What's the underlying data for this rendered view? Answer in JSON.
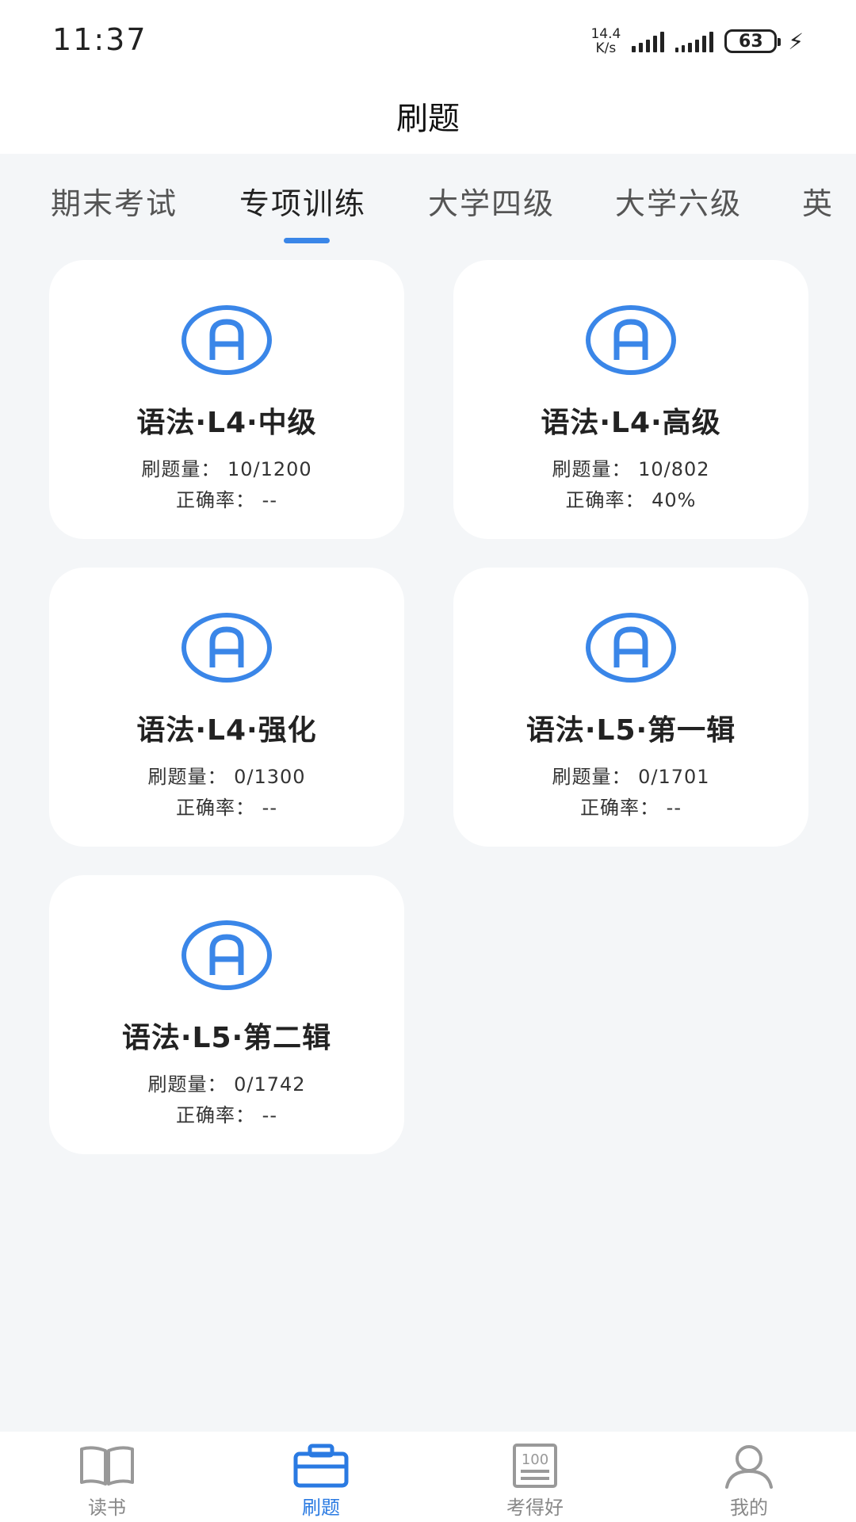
{
  "status_bar": {
    "time": "11:37",
    "net_speed_value": "14.4",
    "net_speed_unit": "K/s",
    "battery": "63"
  },
  "header": {
    "title": "刷题"
  },
  "tabs": [
    {
      "label": "期末考试",
      "active": false
    },
    {
      "label": "专项训练",
      "active": true
    },
    {
      "label": "大学四级",
      "active": false
    },
    {
      "label": "大学六级",
      "active": false
    },
    {
      "label": "英",
      "active": false
    }
  ],
  "cards": [
    {
      "icon": "letter-a-icon",
      "title": "语法·L4·中级",
      "count_label": "刷题量：",
      "count_value": "10/1200",
      "accuracy_label": "正确率：",
      "accuracy_value": "--"
    },
    {
      "icon": "letter-a-icon",
      "title": "语法·L4·高级",
      "count_label": "刷题量：",
      "count_value": "10/802",
      "accuracy_label": "正确率：",
      "accuracy_value": "40%"
    },
    {
      "icon": "letter-a-icon",
      "title": "语法·L4·强化",
      "count_label": "刷题量：",
      "count_value": "0/1300",
      "accuracy_label": "正确率：",
      "accuracy_value": "--"
    },
    {
      "icon": "letter-a-icon",
      "title": "语法·L5·第一辑",
      "count_label": "刷题量：",
      "count_value": "0/1701",
      "accuracy_label": "正确率：",
      "accuracy_value": "--"
    },
    {
      "icon": "letter-a-icon",
      "title": "语法·L5·第二辑",
      "count_label": "刷题量：",
      "count_value": "0/1742",
      "accuracy_label": "正确率：",
      "accuracy_value": "--"
    }
  ],
  "bottom_nav": [
    {
      "label": "读书",
      "icon": "open-book-icon",
      "active": false
    },
    {
      "label": "刷题",
      "icon": "toolbox-icon",
      "active": true
    },
    {
      "label": "考得好",
      "icon": "score-100-icon",
      "active": false,
      "icon_text": "100"
    },
    {
      "label": "我的",
      "icon": "user-icon",
      "active": false
    }
  ],
  "colors": {
    "accent": "#3a86e8",
    "active_nav": "#2a7ae2",
    "background": "#f4f6f8"
  }
}
